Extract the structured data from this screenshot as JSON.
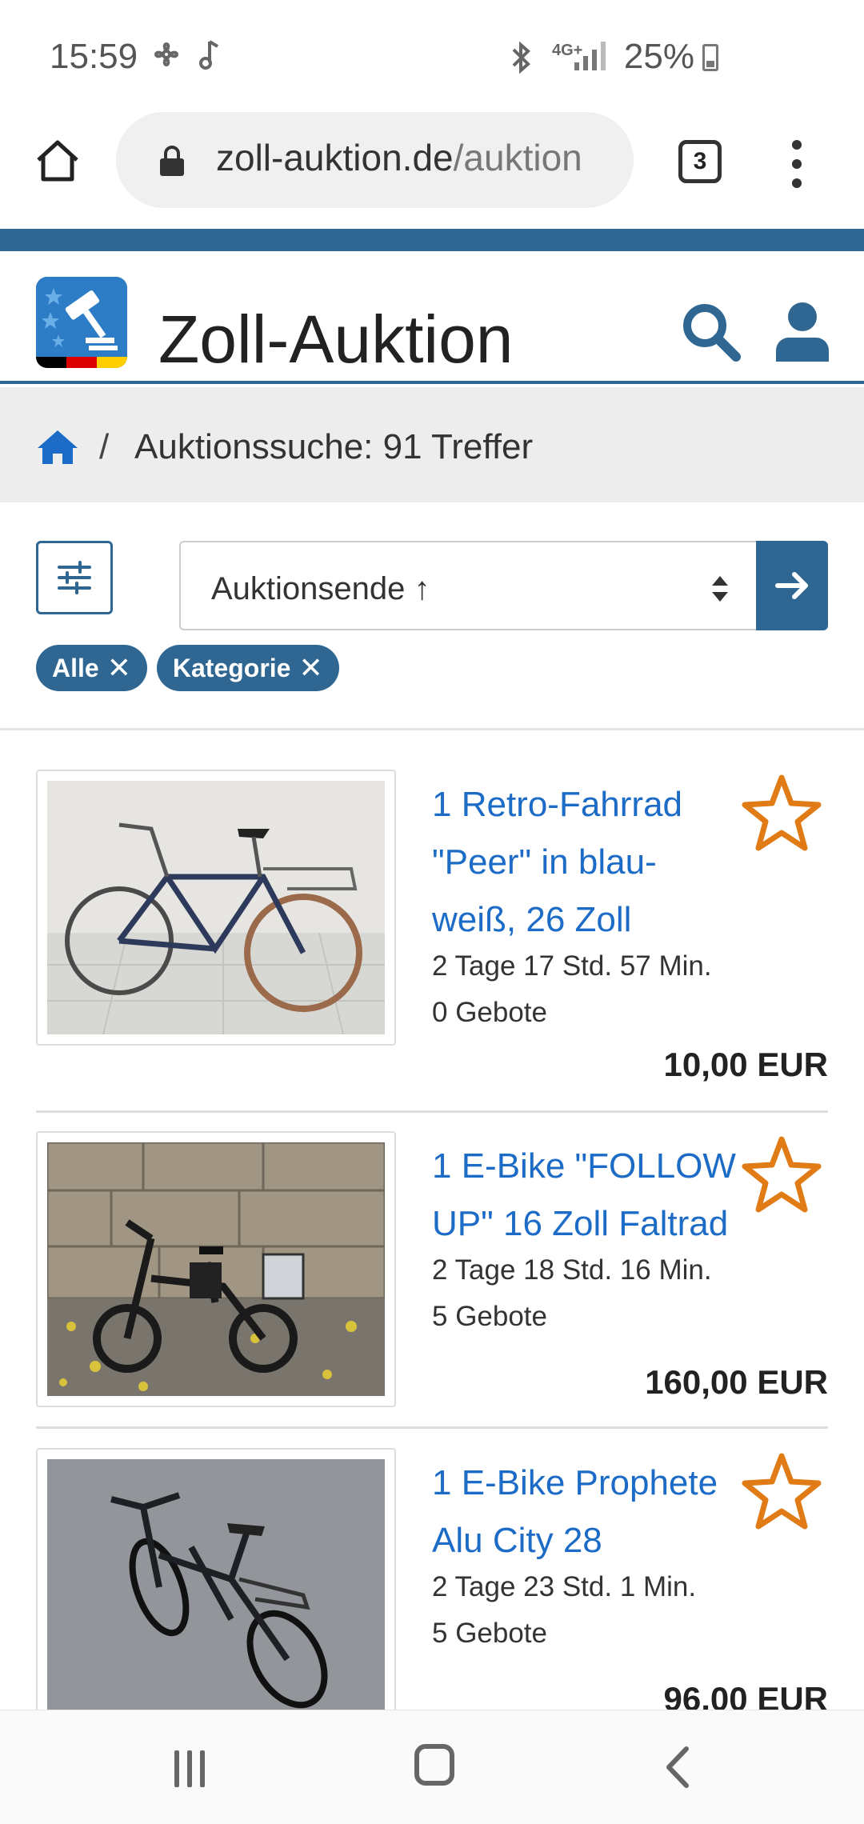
{
  "status_bar": {
    "time": "15:59",
    "network": "4G+",
    "battery": "25%"
  },
  "browser": {
    "url_host": "zoll-auktion.de",
    "url_path": "/auktion",
    "tab_count": "3"
  },
  "site": {
    "title": "Zoll-Auktion",
    "brand_color": "#2f6792",
    "link_color": "#1c6cc7",
    "star_color": "#e07b16"
  },
  "breadcrumb": {
    "separator": "/",
    "text": "Auktionssuche: 91 Treffer"
  },
  "sort": {
    "selected": "Auktionsende ↑"
  },
  "chips": [
    {
      "label": "Alle"
    },
    {
      "label": "Kategorie"
    }
  ],
  "listings": [
    {
      "title": "1 Retro-Fahrrad \"Peer\" in blau-weiß, 26 Zoll",
      "time_left": "2 Tage 17 Std. 57 Min.",
      "bids": "0 Gebote",
      "price": "10,00 EUR"
    },
    {
      "title": "1 E-Bike \"FOLLOW UP\" 16 Zoll Faltrad",
      "time_left": "2 Tage 18 Std. 16 Min.",
      "bids": "5 Gebote",
      "price": "160,00 EUR"
    },
    {
      "title": "1 E-Bike Prophete Alu City 28",
      "time_left": "2 Tage 23 Std. 1 Min.",
      "bids": "5 Gebote",
      "price": "96,00 EUR"
    }
  ]
}
